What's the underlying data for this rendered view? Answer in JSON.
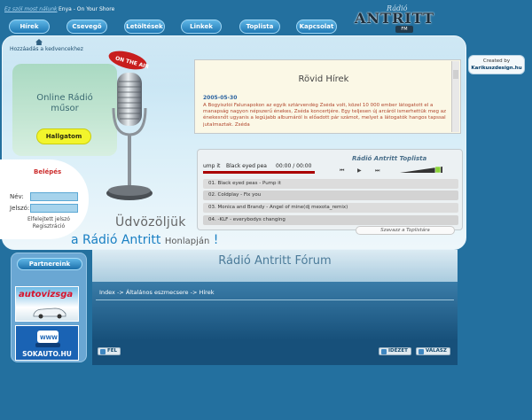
{
  "top": {
    "nowplaying_label": "Ez szól most nálunk",
    "nowplaying_song": "Enya - On Your Shore"
  },
  "logo": {
    "script": "Rádió",
    "main": "ANTRITT",
    "fm": "FM"
  },
  "nav": [
    {
      "label": "Hírek"
    },
    {
      "label": "Csevegő"
    },
    {
      "label": "Letöltések"
    },
    {
      "label": "Linkek"
    },
    {
      "label": "Toplista"
    },
    {
      "label": "Kapcsolat"
    }
  ],
  "header": {
    "favorites": "Hozzáadás a kedvencekhez",
    "radio_title_1": "Online Rádió",
    "radio_title_2": "műsor",
    "listen_button": "Hallgatom",
    "mic_sign": "ON THE AIR"
  },
  "news": {
    "title": "Rövid Hírek",
    "date": "2005-05-30",
    "text": "A Bogyiszlói Falunapokon az egyik sztárvendég Zséda volt, közel 10 000 ember látogatott el a manapság nagyon népszerű énekes, Zséda koncertjére. Egy teljesen új arcáról ismerhettük meg az énekesnőt ugyanis a legújabb albumáról is előadott pár számot, melyet a látogatók hangos tapssal jutalmaztak. Zséda"
  },
  "toplist": {
    "title": "Rádió Antritt Toplista",
    "player": {
      "song": "ump it",
      "artist": "Black eyed pea",
      "time": "00:00 / 00:00",
      "progress": 1.0,
      "volume": 0.95
    },
    "rows": [
      "01. Black eyed peas - Pump it",
      "02. Coldplay - Fix you",
      "03. Monica and Brandy - Angel of mine(dj mexota_remix)",
      "04. -KLF - everybodys changing"
    ],
    "vote": "Szavazz a Toplistára"
  },
  "login": {
    "title": "Belépés",
    "name_label": "Név:",
    "password_label": "Jelszó:",
    "forgot_1": "Elfelejtett jelszó",
    "forgot_2": "Regisztráció"
  },
  "welcome": {
    "line1": "Üdvözöljük",
    "line2_a": "a",
    "line2_b": "Rádió Antritt",
    "line2_c": "Honlapján",
    "line2_d": "!"
  },
  "credit": {
    "line1": "Created by",
    "line2": "Karikuszdesign.hu"
  },
  "partners": {
    "title": "Partnereink",
    "banner1": "autovizsga",
    "banner2_icon": "WWW",
    "banner2": "SOKAUTO.HU"
  },
  "forum": {
    "title": "Rádió Antritt Fórum",
    "breadcrumb": "Index -> Általános eszmecsere -> Hírek",
    "up_button": "FEL",
    "quote_button": "IDÉZET",
    "reply_button": "VÁLASZ"
  },
  "colors": {
    "background": "#23709f",
    "accent_blue": "#1a80c3",
    "listen_yellow": "#f2f52c",
    "news_text": "#b0452c"
  }
}
